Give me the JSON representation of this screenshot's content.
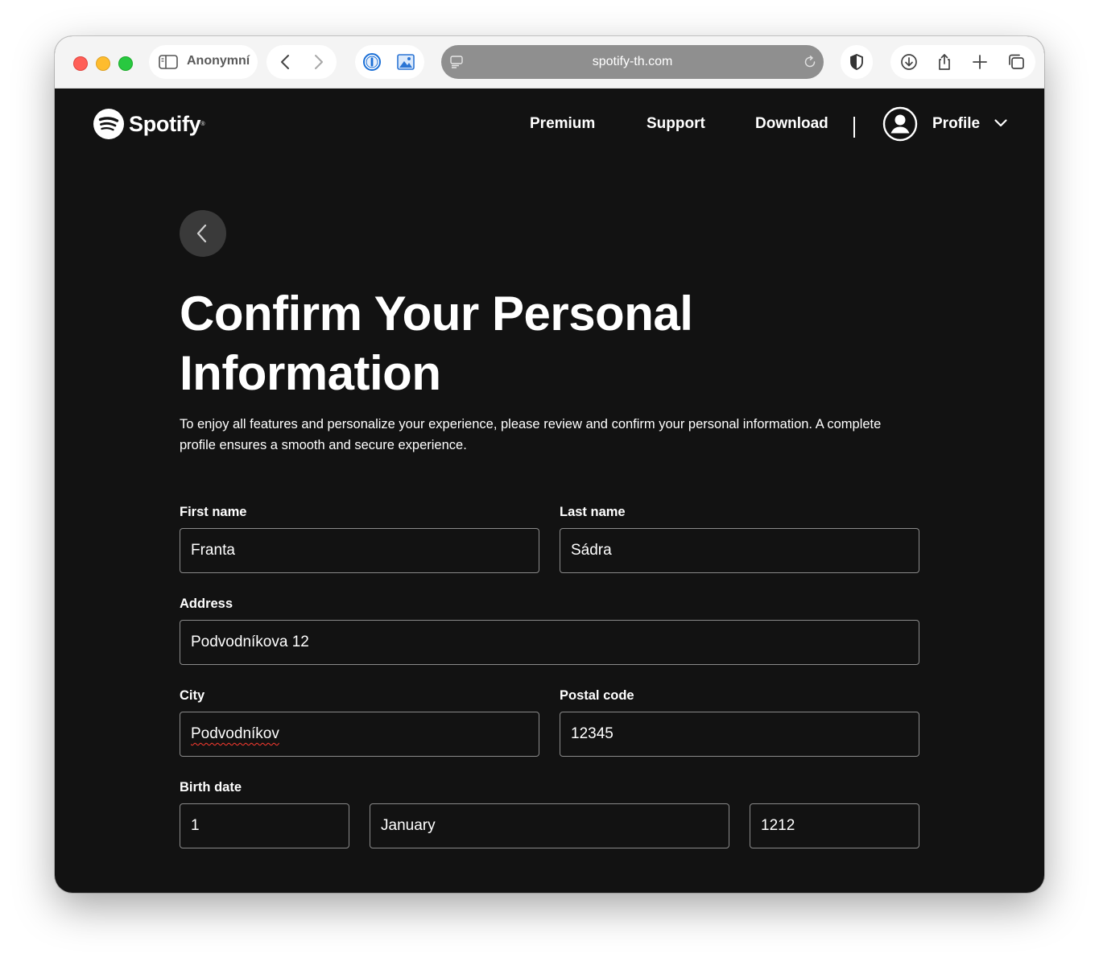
{
  "browser": {
    "tab_label": "Anonymní",
    "url": "spotify-th.com"
  },
  "header": {
    "logo_text": "Spotify",
    "logo_tm": "®",
    "nav": {
      "premium": "Premium",
      "support": "Support",
      "download": "Download"
    },
    "profile_label": "Profile"
  },
  "page": {
    "title": "Confirm Your Personal Information",
    "description": "To enjoy all features and personalize your experience, please review and confirm your personal information. A complete profile ensures a smooth and secure experience."
  },
  "form": {
    "first_name": {
      "label": "First name",
      "value": "Franta"
    },
    "last_name": {
      "label": "Last name",
      "value": "Sádra"
    },
    "address": {
      "label": "Address",
      "value": "Podvodníkova 12"
    },
    "city": {
      "label": "City",
      "value": "Podvodníkov"
    },
    "postal_code": {
      "label": "Postal code",
      "value": "12345"
    },
    "birth_date": {
      "label": "Birth date",
      "day": "1",
      "month": "January",
      "year": "1212"
    }
  },
  "colors": {
    "page_background": "#121212",
    "text": "#ffffff",
    "back_button": "#3a3a3a",
    "field_border": "#8a8a8a"
  },
  "icons": [
    "sidebar-icon",
    "back-arrow-icon",
    "forward-arrow-icon",
    "password-manager-icon",
    "image-extension-icon",
    "site-settings-icon",
    "reload-icon",
    "privacy-shield-icon",
    "download-icon",
    "share-icon",
    "new-tab-icon",
    "tab-overview-icon",
    "spotify-logo-icon",
    "user-avatar-icon",
    "chevron-down-icon",
    "chevron-left-icon"
  ]
}
